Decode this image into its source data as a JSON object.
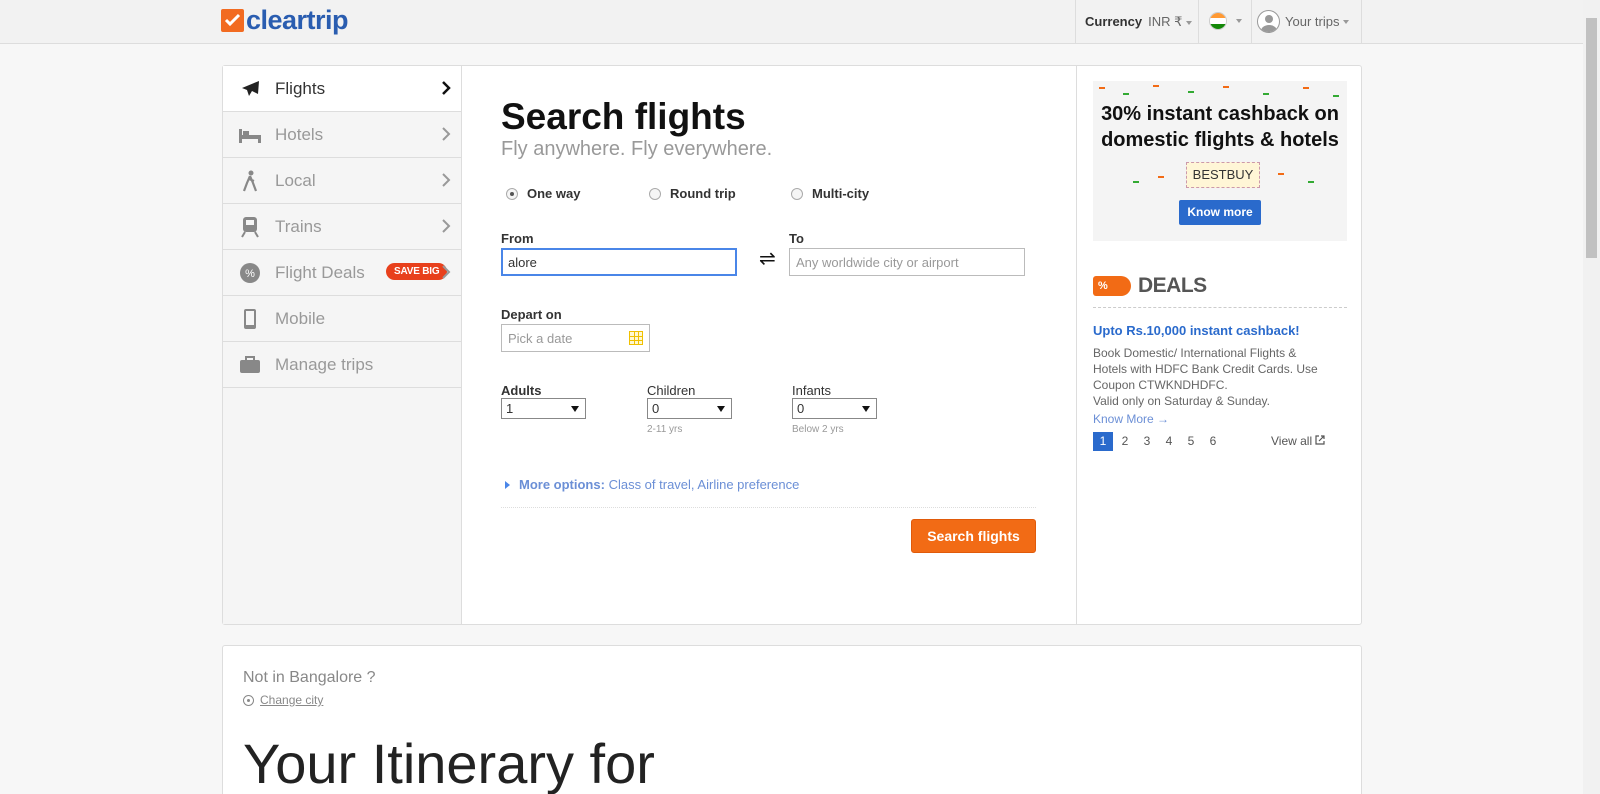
{
  "header": {
    "logo": "cleartrip",
    "currency_label": "Currency",
    "currency_value": "INR ₹",
    "your_trips": "Your trips"
  },
  "nav": [
    {
      "label": "Flights",
      "icon": "airplane-icon",
      "active": true
    },
    {
      "label": "Hotels",
      "icon": "bed-icon"
    },
    {
      "label": "Local",
      "icon": "hiker-icon"
    },
    {
      "label": "Trains",
      "icon": "train-icon"
    },
    {
      "label": "Flight Deals",
      "icon": "percent-badge-icon",
      "badge": "SAVE BIG"
    },
    {
      "label": "Mobile",
      "icon": "mobile-icon"
    },
    {
      "label": "Manage trips",
      "icon": "briefcase-icon"
    }
  ],
  "search": {
    "title": "Search flights",
    "subtitle": "Fly anywhere. Fly everywhere.",
    "trip_types": [
      "One way",
      "Round trip",
      "Multi-city"
    ],
    "from_label": "From",
    "from_value": "alore",
    "to_label": "To",
    "to_placeholder": "Any worldwide city or airport",
    "depart_label": "Depart on",
    "depart_placeholder": "Pick a date",
    "adults_label": "Adults",
    "adults_value": "1",
    "children_label": "Children",
    "children_value": "0",
    "children_hint": "2-11 yrs",
    "infants_label": "Infants",
    "infants_value": "0",
    "infants_hint": "Below 2 yrs",
    "more_options_label": "More options:",
    "more_options_text": "Class of travel, Airline preference",
    "search_button": "Search flights"
  },
  "promo": {
    "headline_1": "30% instant cashback on",
    "headline_2": "domestic flights & hotels",
    "coupon": "BESTBUY",
    "button": "Know more"
  },
  "deals": {
    "tag": "%",
    "title": "DEALS",
    "link": "Upto Rs.10,000 instant cashback!",
    "body": "Book Domestic/ International Flights & Hotels with HDFC Bank Credit Cards. Use Coupon CTWKNDHDFC.",
    "validity": "Valid only on Saturday & Sunday.",
    "know_more": "Know More →",
    "pages": [
      "1",
      "2",
      "3",
      "4",
      "5",
      "6"
    ],
    "view_all": "View all"
  },
  "city": {
    "not_in": "Not in Bangalore ?",
    "change": "Change city",
    "itinerary": "Your Itinerary for"
  },
  "colors": {
    "brand_orange": "#f26b15",
    "brand_blue": "#2a6acc"
  }
}
